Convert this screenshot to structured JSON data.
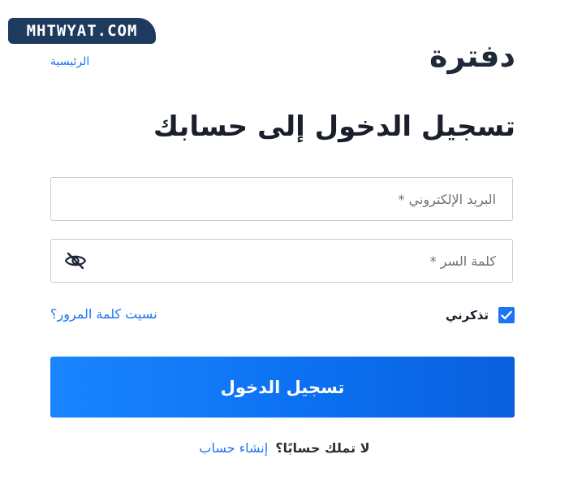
{
  "watermark": "MHTWYAT.COM",
  "brand": {
    "name": "دفترة",
    "accent_color": "#1d74f5"
  },
  "nav": {
    "home_label": "الرئيسية"
  },
  "login": {
    "title": "تسجيل الدخول إلى حسابك",
    "email_placeholder": "البريد الإلكتروني *",
    "password_placeholder": "كلمة السر *",
    "password_toggle_icon": "eye-slash-icon",
    "remember_label": "تذكرني",
    "remember_checked": true,
    "forgot_label": "نسيت كلمة المرور؟",
    "submit_label": "تسجيل الدخول"
  },
  "signup": {
    "question": "لا تملك حسابًا؟",
    "link_label": "إنشاء حساب"
  }
}
